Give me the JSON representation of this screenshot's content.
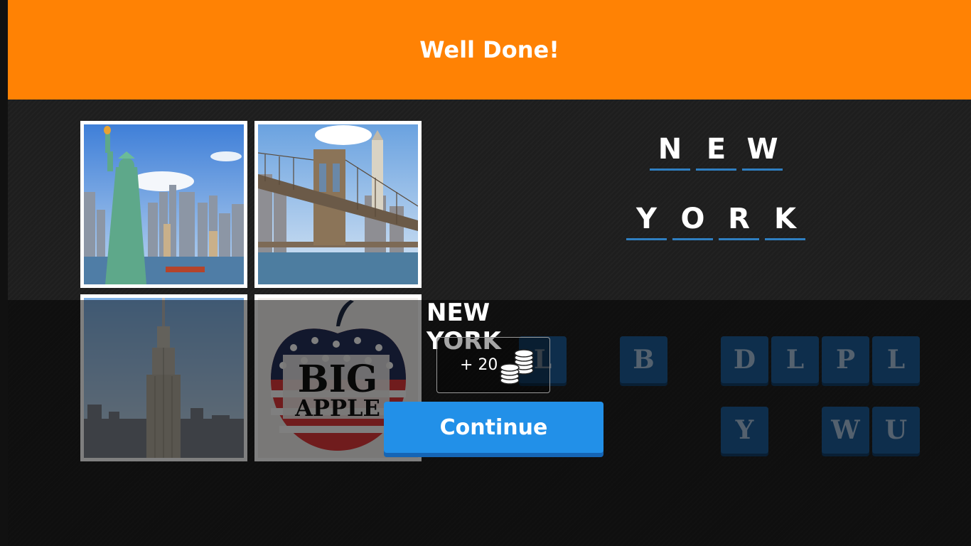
{
  "banner": {
    "title": "Well Done!"
  },
  "images": [
    {
      "name": "statue-of-liberty"
    },
    {
      "name": "brooklyn-bridge"
    },
    {
      "name": "empire-state-building"
    },
    {
      "name": "big-apple",
      "line1": "BIG",
      "line2": "APPLE"
    }
  ],
  "answer": {
    "word1": [
      "N",
      "E",
      "W"
    ],
    "word2": [
      "Y",
      "O",
      "R",
      "K"
    ],
    "solved_text": "NEW YORK"
  },
  "keys": {
    "row1": [
      "L",
      "B",
      "D",
      "L",
      "P",
      "L"
    ],
    "row2": [
      "Y",
      "W",
      "U"
    ]
  },
  "reward": {
    "text": "+ 20",
    "icon": "coins-icon"
  },
  "continue_label": "Continue",
  "colors": {
    "banner": "#ff8204",
    "slot_underline": "#2f7fc1",
    "key": "#1d5d99",
    "button": "#2290e8"
  }
}
